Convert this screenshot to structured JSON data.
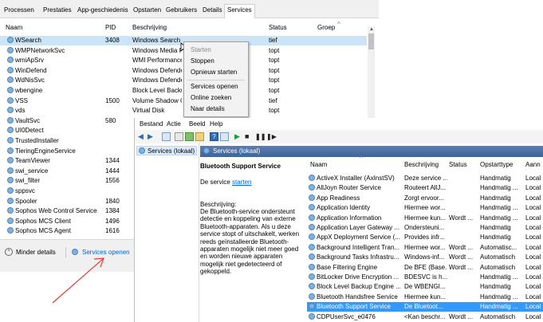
{
  "taskmanager": {
    "tabs": [
      "Processen",
      "Prestaties",
      "App-geschiedenis",
      "Opstarten",
      "Gebruikers",
      "Details",
      "Services"
    ],
    "active_tab": "Services",
    "columns": {
      "name": "Naam",
      "pid": "PID",
      "desc": "Beschrijving",
      "status": "Status",
      "group": "Groep"
    },
    "rows": [
      {
        "name": "WSearch",
        "pid": "3408",
        "desc": "Windows Search",
        "status": "tief"
      },
      {
        "name": "WMPNetworkSvc",
        "pid": "",
        "desc": "Windows Media P",
        "status": "topt"
      },
      {
        "name": "wmiApSrv",
        "pid": "",
        "desc": "WMI Performance",
        "status": "topt"
      },
      {
        "name": "WinDefend",
        "pid": "",
        "desc": "Windows Defender",
        "status": "topt"
      },
      {
        "name": "WdNisSvc",
        "pid": "",
        "desc": "Windows Defender",
        "status": "topt"
      },
      {
        "name": "wbengine",
        "pid": "",
        "desc": "Block Level Backup",
        "status": "topt"
      },
      {
        "name": "VSS",
        "pid": "1500",
        "desc": "Volume Shadow C",
        "status": "tief"
      },
      {
        "name": "vds",
        "pid": "",
        "desc": "Virtual Disk",
        "status": "topt"
      },
      {
        "name": "VaultSvc",
        "pid": "580",
        "desc": "",
        "status": ""
      },
      {
        "name": "UI0Detect",
        "pid": "",
        "desc": "",
        "status": ""
      },
      {
        "name": "TrustedInstaller",
        "pid": "",
        "desc": "",
        "status": ""
      },
      {
        "name": "TieringEngineService",
        "pid": "",
        "desc": "",
        "status": ""
      },
      {
        "name": "TeamViewer",
        "pid": "1344",
        "desc": "",
        "status": ""
      },
      {
        "name": "swi_service",
        "pid": "1444",
        "desc": "",
        "status": ""
      },
      {
        "name": "swi_filter",
        "pid": "1556",
        "desc": "",
        "status": ""
      },
      {
        "name": "sppsvc",
        "pid": "",
        "desc": "",
        "status": ""
      },
      {
        "name": "Spooler",
        "pid": "1840",
        "desc": "",
        "status": ""
      },
      {
        "name": "Sophos Web Control Service",
        "pid": "1384",
        "desc": "",
        "status": ""
      },
      {
        "name": "Sophos MCS Client",
        "pid": "1496",
        "desc": "",
        "status": ""
      },
      {
        "name": "Sophos MCS Agent",
        "pid": "1616",
        "desc": "",
        "status": ""
      }
    ],
    "footer": {
      "less_details": "Minder details",
      "open_services": "Services openen"
    }
  },
  "context_menu": {
    "items": [
      "Starten",
      "Stoppen",
      "Opnieuw starten",
      "Services openen",
      "Online zoeken",
      "Naar details"
    ]
  },
  "services": {
    "menu": [
      "Bestand",
      "Actie",
      "Beeld",
      "Help"
    ],
    "tree_item": "Services (lokaal)",
    "pane_title": "Services (lokaal)",
    "selected_title": "Bluetooth Support Service",
    "start_prefix": "De service ",
    "start_link": "starten",
    "desc_label": "Beschrijving:",
    "desc_text": "De Bluetooth-service ondersteunt detectie en koppeling van externe Bluetooth-apparaten. Als u deze service stopt of uitschakelt, werken reeds geïnstalleerde Bluetooth-apparaten mogelijk niet meer goed en worden nieuwe apparaten mogelijk niet gedetecteerd of gekoppeld.",
    "columns": {
      "name": "Naam",
      "desc": "Beschrijving",
      "status": "Status",
      "startup": "Opstarttype",
      "logon": "Aann"
    },
    "rows": [
      {
        "name": "ActiveX Installer (AxInstSV)",
        "desc": "Deze service ...",
        "status": "",
        "startup": "Handmatig",
        "logon": "Local"
      },
      {
        "name": "AllJoyn Router Service",
        "desc": "Routeert AllJ...",
        "status": "",
        "startup": "Handmatig ...",
        "logon": "Local"
      },
      {
        "name": "App Readiness",
        "desc": "Zorgt ervoor...",
        "status": "",
        "startup": "Handmatig",
        "logon": "Local"
      },
      {
        "name": "Application Identity",
        "desc": "Hiermee wor...",
        "status": "",
        "startup": "Handmatig ...",
        "logon": "Local"
      },
      {
        "name": "Application Information",
        "desc": "Hiermee kun...",
        "status": "Wordt ...",
        "startup": "Handmatig ...",
        "logon": "Local"
      },
      {
        "name": "Application Layer Gateway ...",
        "desc": "Ondersteuni...",
        "status": "",
        "startup": "Handmatig",
        "logon": "Local"
      },
      {
        "name": "AppX Deployment Service (...",
        "desc": "Provides infr...",
        "status": "",
        "startup": "Handmatig",
        "logon": "Local"
      },
      {
        "name": "Background Intelligent Tran...",
        "desc": "Hiermee wor...",
        "status": "Wordt ...",
        "startup": "Automatisc...",
        "logon": "Local"
      },
      {
        "name": "Background Tasks Infrastru...",
        "desc": "Windows-inf...",
        "status": "Wordt ...",
        "startup": "Automatisch",
        "logon": "Local"
      },
      {
        "name": "Base Filtering Engine",
        "desc": "De BFE (Base...",
        "status": "Wordt ...",
        "startup": "Automatisch",
        "logon": "Local"
      },
      {
        "name": "BitLocker Drive Encryption ...",
        "desc": "BDESVC is h...",
        "status": "",
        "startup": "Handmatig ...",
        "logon": "Local"
      },
      {
        "name": "Block Level Backup Engine ...",
        "desc": "De WBENGI...",
        "status": "",
        "startup": "Handmatig",
        "logon": "Local"
      },
      {
        "name": "Bluetooth Handsfree Service",
        "desc": "Hiermee kun...",
        "status": "",
        "startup": "Handmatig ...",
        "logon": "Local"
      },
      {
        "name": "Bluetooth Support Service",
        "desc": "De Bluetoot...",
        "status": "",
        "startup": "Handmatig ...",
        "logon": "Local"
      },
      {
        "name": "CDPUserSvc_e0476",
        "desc": "<Kan beschr...",
        "status": "Wordt ...",
        "startup": "Automatisch",
        "logon": "Local"
      }
    ],
    "selected_index": 13
  },
  "colors": {
    "selection": "#cce4f7",
    "list_selection": "#3399ff",
    "link": "#0066cc",
    "arrow": "#e23b3b"
  }
}
